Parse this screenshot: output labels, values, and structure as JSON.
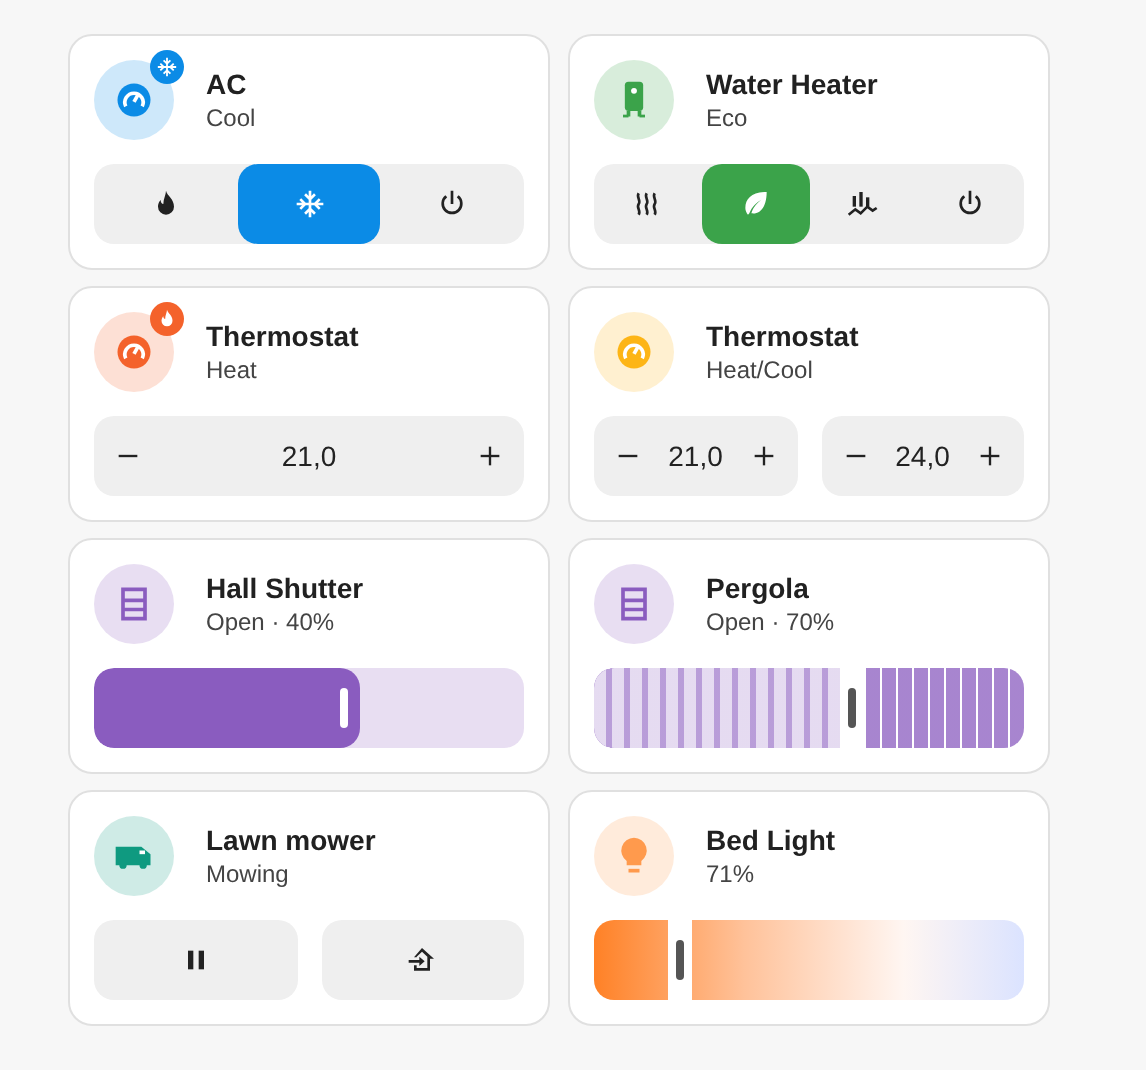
{
  "cards": [
    {
      "name": "AC",
      "state": "Cool",
      "kind": "climate",
      "color": "#0b8be6",
      "badge": {
        "kind": "cooling"
      },
      "control": {
        "kind": "modes",
        "modes": [
          {
            "kind": "heat",
            "selected": false
          },
          {
            "kind": "cool",
            "selected": true
          },
          {
            "kind": "off",
            "selected": false
          }
        ]
      }
    },
    {
      "name": "Water Heater",
      "state": "Eco",
      "kind": "water_heater",
      "color": "#3ba34a",
      "control": {
        "kind": "modes",
        "modes": [
          {
            "kind": "electric",
            "selected": false
          },
          {
            "kind": "eco",
            "selected": true
          },
          {
            "kind": "performance",
            "selected": false
          },
          {
            "kind": "off",
            "selected": false
          }
        ]
      }
    },
    {
      "name": "Thermostat",
      "state": "Heat",
      "kind": "climate",
      "color": "#f4622b",
      "badge": {
        "kind": "heating"
      },
      "control": {
        "kind": "target",
        "values": [
          "21,0"
        ]
      }
    },
    {
      "name": "Thermostat",
      "state": "Heat/Cool",
      "kind": "climate",
      "color": "#fdb516",
      "control": {
        "kind": "target",
        "values": [
          "21,0",
          "24,0"
        ]
      }
    },
    {
      "name": "Hall Shutter",
      "state": "Open · 40%",
      "kind": "cover",
      "color": "#8a5cbf",
      "control": {
        "kind": "slider",
        "level": 0.62
      }
    },
    {
      "name": "Pergola",
      "state": "Open · 70%",
      "kind": "cover",
      "color": "#8a5cbf",
      "control": {
        "kind": "striped_slider",
        "level": 0.6
      }
    },
    {
      "name": "Lawn mower",
      "state": "Mowing",
      "kind": "lawn_mower",
      "color": "#0f9a80",
      "control": {
        "kind": "actions",
        "buttons": [
          {
            "kind": "pause"
          },
          {
            "kind": "dock"
          }
        ]
      }
    },
    {
      "name": "Bed Light",
      "state": "71%",
      "kind": "light",
      "color": "#ff9a4d",
      "control": {
        "kind": "brightness",
        "level": 0.2
      }
    }
  ]
}
